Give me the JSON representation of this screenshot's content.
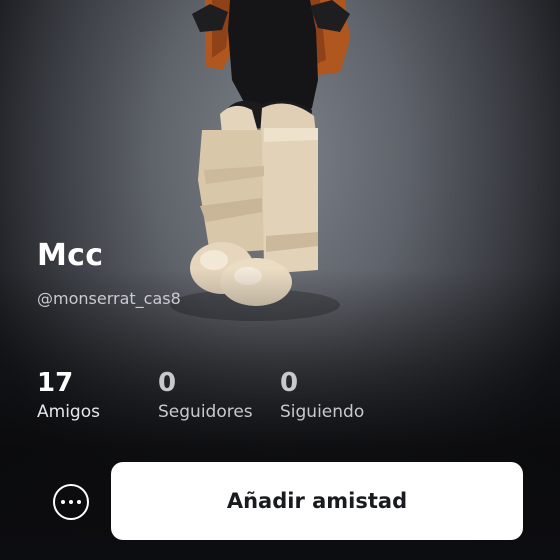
{
  "profile": {
    "display_name": "Mcc",
    "username": "@monserrat_cas8"
  },
  "stats": [
    {
      "value": "17",
      "label": "Amigos"
    },
    {
      "value": "0",
      "label": "Seguidores"
    },
    {
      "value": "0",
      "label": "Siguiendo"
    }
  ],
  "actions": {
    "more_icon": "more-horizontal-icon",
    "add_friend_label": "Añadir amistad"
  },
  "colors": {
    "button_bg": "#ffffff",
    "text_primary": "#ffffff",
    "text_secondary": "#c9cbcf"
  }
}
